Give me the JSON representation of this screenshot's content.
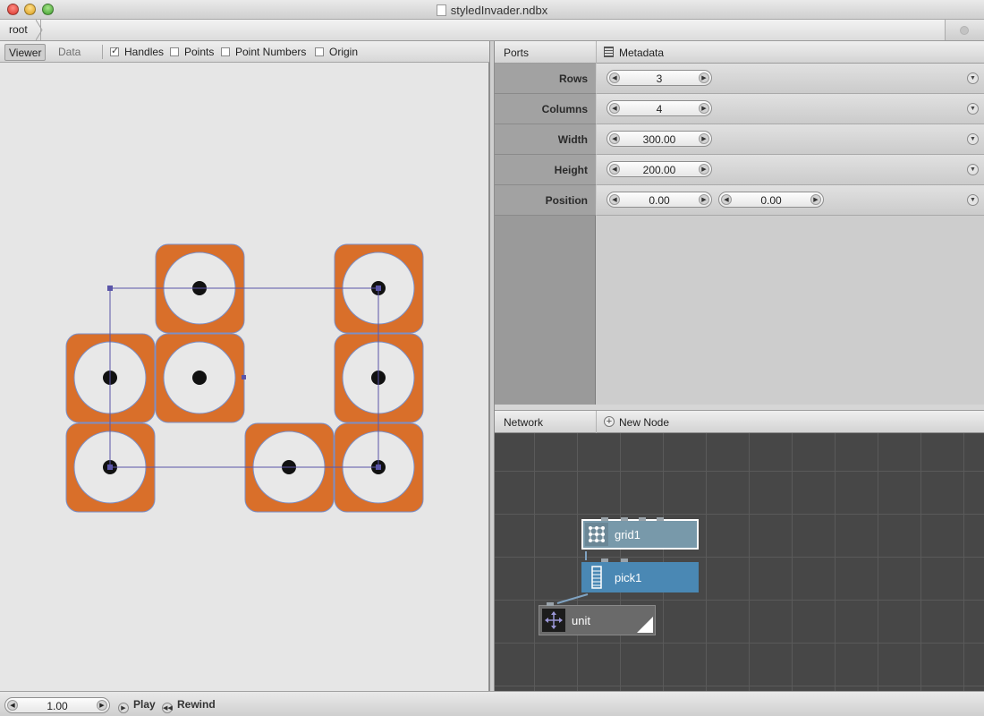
{
  "window": {
    "title": "styledInvader.ndbx"
  },
  "breadcrumb": {
    "root": "root"
  },
  "viewer": {
    "tabs": [
      {
        "label": "Viewer",
        "active": true
      },
      {
        "label": "Data",
        "active": false
      }
    ],
    "checkboxes": [
      {
        "label": "Handles",
        "checked": true
      },
      {
        "label": "Points",
        "checked": false
      },
      {
        "label": "Point Numbers",
        "checked": false
      },
      {
        "label": "Origin",
        "checked": false
      }
    ],
    "colors": {
      "tile_fill": "#d96f2a",
      "tile_stroke": "#7a8fc8",
      "circle_fill": "#e8e8e8",
      "dot": "#111111",
      "handle": "#5a55a8"
    }
  },
  "ports_panel": {
    "title": "Ports",
    "metadata_label": "Metadata",
    "rows": [
      {
        "label": "Rows",
        "values": [
          "3"
        ]
      },
      {
        "label": "Columns",
        "values": [
          "4"
        ]
      },
      {
        "label": "Width",
        "values": [
          "300.00"
        ]
      },
      {
        "label": "Height",
        "values": [
          "200.00"
        ]
      },
      {
        "label": "Position",
        "values": [
          "0.00",
          "0.00"
        ]
      }
    ]
  },
  "network_panel": {
    "title": "Network",
    "new_node_label": "New Node",
    "nodes": [
      {
        "name": "grid1",
        "color": "#7899aa",
        "icon": "grid-icon",
        "selected": true
      },
      {
        "name": "pick1",
        "color": "#4a88b4",
        "icon": "pick-icon",
        "selected": false
      },
      {
        "name": "unit",
        "color": "#6a6a6a",
        "icon": "move-icon",
        "selected": false
      }
    ]
  },
  "bottom_bar": {
    "frame_value": "1.00",
    "play_label": "Play",
    "rewind_label": "Rewind"
  }
}
